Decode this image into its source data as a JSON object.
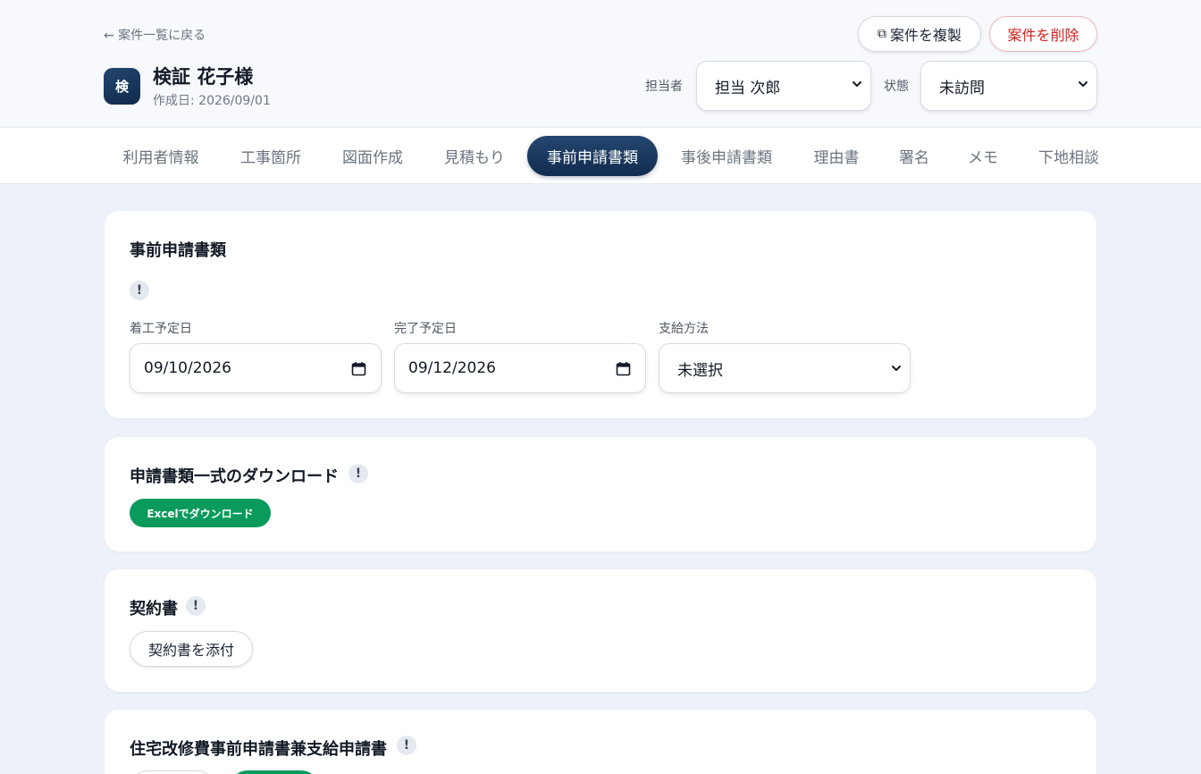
{
  "header": {
    "back_label": "← 案件一覧に戻る",
    "avatar_text": "検",
    "client_name": "検証 花子様",
    "created_date": "作成日: 2026/09/01",
    "duplicate_icon": "⧉",
    "duplicate_label": "案件を複製",
    "delete_label": "案件を削除",
    "assignee_label": "担当者",
    "assignee_value": "担当 次郎",
    "status_label": "状態",
    "status_value": "未訪問"
  },
  "tabs": [
    {
      "label": "利用者情報"
    },
    {
      "label": "工事箇所"
    },
    {
      "label": "図面作成"
    },
    {
      "label": "見積もり"
    },
    {
      "label": "事前申請書類"
    },
    {
      "label": "事後申請書類"
    },
    {
      "label": "理由書"
    },
    {
      "label": "署名"
    },
    {
      "label": "メモ"
    },
    {
      "label": "下地相談"
    }
  ],
  "active_tab": "事前申請書類",
  "cards": {
    "pre_application": {
      "title": "事前申請書類",
      "info": "!",
      "start_label": "着工予定日",
      "start_value": "09/10/2026",
      "end_label": "完了予定日",
      "end_value": "09/12/2026",
      "payment_label": "支給方法",
      "payment_value": "未選択"
    },
    "download": {
      "title": "申請書類一式のダウンロード",
      "info": "!",
      "button_label": "Excelでダウンロード"
    },
    "contract": {
      "title": "契約書",
      "info": "!",
      "button_label": "契約書を添付"
    },
    "renovation": {
      "title": "住宅改修費事前申請書兼支給申請書",
      "info": "!"
    }
  },
  "colors": {
    "primary": "#163559",
    "success": "#0a9a5c",
    "danger": "#d01f1f",
    "background": "#edf2fa"
  },
  "icons": {
    "back": "arrow-left-icon",
    "duplicate": "copy-icon",
    "dropdown": "chevron-down-icon",
    "date": "calendar-icon",
    "info": "exclamation-icon"
  }
}
